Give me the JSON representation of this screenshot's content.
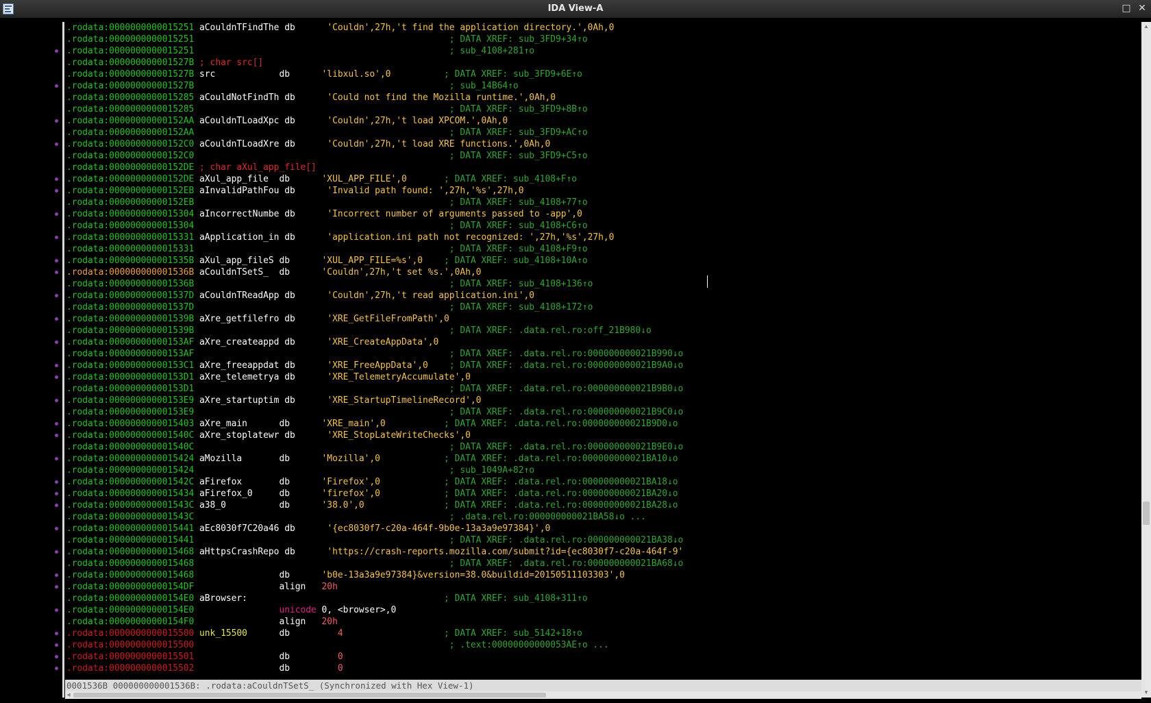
{
  "window": {
    "title": "IDA View-A",
    "app_icon": "ida-icon",
    "buttons": {
      "maximize": "□",
      "close": "✕"
    }
  },
  "listing": [
    {
      "addr": ".rodata:0000000000015251",
      "label": "aCouldnTFindThe",
      "ins": "db",
      "op": "'Couldn',27h,'t find the application directory.',0Ah,0",
      "cmt": ""
    },
    {
      "addr": ".rodata:0000000000015251",
      "label": "",
      "ins": "",
      "op": "",
      "cmt": "; DATA XREF: sub_3FD9+34↑o"
    },
    {
      "addr": ".rodata:0000000000015251",
      "label": "",
      "ins": "",
      "op": "",
      "cmt": "; sub_4108+281↑o"
    },
    {
      "addr": ".rodata:000000000001527B",
      "label": "",
      "ins": "",
      "op": "",
      "cmt": "; char src[]",
      "cmt_red": true,
      "cmt_inline": true
    },
    {
      "addr": ".rodata:000000000001527B",
      "label": "src",
      "ins": "db",
      "op": "'libxul.so',0",
      "cmt": "; DATA XREF: sub_3FD9+6E↑o"
    },
    {
      "addr": ".rodata:000000000001527B",
      "label": "",
      "ins": "",
      "op": "",
      "cmt": "; sub_14B64↑o"
    },
    {
      "addr": ".rodata:0000000000015285",
      "label": "aCouldNotFindTh",
      "ins": "db",
      "op": "'Could not find the Mozilla runtime.',0Ah,0",
      "cmt": ""
    },
    {
      "addr": ".rodata:0000000000015285",
      "label": "",
      "ins": "",
      "op": "",
      "cmt": "; DATA XREF: sub_3FD9+8B↑o"
    },
    {
      "addr": ".rodata:00000000000152AA",
      "label": "aCouldnTLoadXpc",
      "ins": "db",
      "op": "'Couldn',27h,'t load XPCOM.',0Ah,0",
      "cmt": ""
    },
    {
      "addr": ".rodata:00000000000152AA",
      "label": "",
      "ins": "",
      "op": "",
      "cmt": "; DATA XREF: sub_3FD9+AC↑o"
    },
    {
      "addr": ".rodata:00000000000152C0",
      "label": "aCouldnTLoadXre",
      "ins": "db",
      "op": "'Couldn',27h,'t load XRE functions.',0Ah,0",
      "cmt": ""
    },
    {
      "addr": ".rodata:00000000000152C0",
      "label": "",
      "ins": "",
      "op": "",
      "cmt": "; DATA XREF: sub_3FD9+C5↑o"
    },
    {
      "addr": ".rodata:00000000000152DE",
      "label": "",
      "ins": "",
      "op": "",
      "cmt": "; char aXul_app_file[]",
      "cmt_red": true,
      "cmt_inline": true
    },
    {
      "addr": ".rodata:00000000000152DE",
      "label": "aXul_app_file",
      "ins": "db",
      "op": "'XUL_APP_FILE',0",
      "cmt": "; DATA XREF: sub_4108+F↑o"
    },
    {
      "addr": ".rodata:00000000000152EB",
      "label": "aInvalidPathFou",
      "ins": "db",
      "op": "'Invalid path found: ',27h,'%s',27h,0",
      "cmt": ""
    },
    {
      "addr": ".rodata:00000000000152EB",
      "label": "",
      "ins": "",
      "op": "",
      "cmt": "; DATA XREF: sub_4108+77↑o"
    },
    {
      "addr": ".rodata:0000000000015304",
      "label": "aIncorrectNumbe",
      "ins": "db",
      "op": "'Incorrect number of arguments passed to -app',0",
      "cmt": ""
    },
    {
      "addr": ".rodata:0000000000015304",
      "label": "",
      "ins": "",
      "op": "",
      "cmt": "; DATA XREF: sub_4108+C6↑o"
    },
    {
      "addr": ".rodata:0000000000015331",
      "label": "aApplication_in",
      "ins": "db",
      "op": "'application.ini path not recognized: ',27h,'%s',27h,0",
      "cmt": ""
    },
    {
      "addr": ".rodata:0000000000015331",
      "label": "",
      "ins": "",
      "op": "",
      "cmt": "; DATA XREF: sub_4108+F9↑o"
    },
    {
      "addr": ".rodata:000000000001535B",
      "label": "aXul_app_fileS",
      "ins": "db",
      "op": "'XUL_APP_FILE=%s',0",
      "cmt": "; DATA XREF: sub_4108+10A↑o"
    },
    {
      "addr": ".rodata:000000000001536B",
      "label": "aCouldnTSetS_",
      "ins": "db",
      "op": "'Couldn',27h,'t set %s.',0Ah,0",
      "cmt": "",
      "addr_orange": true
    },
    {
      "addr": ".rodata:000000000001536B",
      "label": "",
      "ins": "",
      "op": "",
      "cmt": "; DATA XREF: sub_4108+136↑o"
    },
    {
      "addr": ".rodata:000000000001537D",
      "label": "aCouldnTReadApp",
      "ins": "db",
      "op": "'Couldn',27h,'t read application.ini',0",
      "cmt": ""
    },
    {
      "addr": ".rodata:000000000001537D",
      "label": "",
      "ins": "",
      "op": "",
      "cmt": "; DATA XREF: sub_4108+172↑o"
    },
    {
      "addr": ".rodata:000000000001539B",
      "label": "aXre_getfilefro",
      "ins": "db",
      "op": "'XRE_GetFileFromPath',0",
      "cmt": ""
    },
    {
      "addr": ".rodata:000000000001539B",
      "label": "",
      "ins": "",
      "op": "",
      "cmt": "; DATA XREF: .data.rel.ro:off_21B980↓o"
    },
    {
      "addr": ".rodata:00000000000153AF",
      "label": "aXre_createappd",
      "ins": "db",
      "op": "'XRE_CreateAppData',0",
      "cmt": ""
    },
    {
      "addr": ".rodata:00000000000153AF",
      "label": "",
      "ins": "",
      "op": "",
      "cmt": "; DATA XREF: .data.rel.ro:000000000021B990↓o"
    },
    {
      "addr": ".rodata:00000000000153C1",
      "label": "aXre_freeappdat",
      "ins": "db",
      "op": "'XRE_FreeAppData',0",
      "cmt": "; DATA XREF: .data.rel.ro:000000000021B9A0↓o"
    },
    {
      "addr": ".rodata:00000000000153D1",
      "label": "aXre_telemetrya",
      "ins": "db",
      "op": "'XRE_TelemetryAccumulate',0",
      "cmt": ""
    },
    {
      "addr": ".rodata:00000000000153D1",
      "label": "",
      "ins": "",
      "op": "",
      "cmt": "; DATA XREF: .data.rel.ro:000000000021B9B0↓o"
    },
    {
      "addr": ".rodata:00000000000153E9",
      "label": "aXre_startuptim",
      "ins": "db",
      "op": "'XRE_StartupTimelineRecord',0",
      "cmt": ""
    },
    {
      "addr": ".rodata:00000000000153E9",
      "label": "",
      "ins": "",
      "op": "",
      "cmt": "; DATA XREF: .data.rel.ro:000000000021B9C0↓o"
    },
    {
      "addr": ".rodata:0000000000015403",
      "label": "aXre_main",
      "ins": "db",
      "op": "'XRE_main',0",
      "cmt": "; DATA XREF: .data.rel.ro:000000000021B9D0↓o"
    },
    {
      "addr": ".rodata:000000000001540C",
      "label": "aXre_stoplatewr",
      "ins": "db",
      "op": "'XRE_StopLateWriteChecks',0",
      "cmt": ""
    },
    {
      "addr": ".rodata:000000000001540C",
      "label": "",
      "ins": "",
      "op": "",
      "cmt": "; DATA XREF: .data.rel.ro:000000000021B9E0↓o"
    },
    {
      "addr": ".rodata:0000000000015424",
      "label": "aMozilla",
      "ins": "db",
      "op": "'Mozilla',0",
      "cmt": "; DATA XREF: .data.rel.ro:000000000021BA10↓o"
    },
    {
      "addr": ".rodata:0000000000015424",
      "label": "",
      "ins": "",
      "op": "",
      "cmt": "; sub_1049A+82↑o"
    },
    {
      "addr": ".rodata:000000000001542C",
      "label": "aFirefox",
      "ins": "db",
      "op": "'Firefox',0",
      "cmt": "; DATA XREF: .data.rel.ro:000000000021BA18↓o"
    },
    {
      "addr": ".rodata:0000000000015434",
      "label": "aFirefox_0",
      "ins": "db",
      "op": "'firefox',0",
      "cmt": "; DATA XREF: .data.rel.ro:000000000021BA20↓o"
    },
    {
      "addr": ".rodata:000000000001543C",
      "label": "a38_0",
      "ins": "db",
      "op": "'38.0',0",
      "cmt": "; DATA XREF: .data.rel.ro:000000000021BA28↓o"
    },
    {
      "addr": ".rodata:000000000001543C",
      "label": "",
      "ins": "",
      "op": "",
      "cmt": "; .data.rel.ro:000000000021BA58↓o ..."
    },
    {
      "addr": ".rodata:0000000000015441",
      "label": "aEc8030f7C20a46",
      "ins": "db",
      "op": "'{ec8030f7-c20a-464f-9b0e-13a3a9e97384}',0",
      "cmt": ""
    },
    {
      "addr": ".rodata:0000000000015441",
      "label": "",
      "ins": "",
      "op": "",
      "cmt": "; DATA XREF: .data.rel.ro:000000000021BA38↓o"
    },
    {
      "addr": ".rodata:0000000000015468",
      "label": "aHttpsCrashRepo",
      "ins": "db",
      "op": "'https://crash-reports.mozilla.com/submit?id={ec8030f7-c20a-464f-9'",
      "cmt": ""
    },
    {
      "addr": ".rodata:0000000000015468",
      "label": "",
      "ins": "",
      "op": "",
      "cmt": "; DATA XREF: .data.rel.ro:000000000021BA68↓o"
    },
    {
      "addr": ".rodata:0000000000015468",
      "label": "",
      "ins": "db",
      "op": "'b0e-13a3a9e97384}&version=38.0&buildid=20150511103303',0",
      "cmt": ""
    },
    {
      "addr": ".rodata:00000000000154DF",
      "label": "",
      "ins": "align",
      "op": "20h",
      "cmt": "",
      "op_red": true
    },
    {
      "addr": ".rodata:00000000000154E0",
      "label": "aBrowser:",
      "ins": "",
      "op": "",
      "cmt": "; DATA XREF: sub_4108+311↑o"
    },
    {
      "addr": ".rodata:00000000000154E0",
      "label": "",
      "ins": "unicode",
      "op": "0, <browser>,0",
      "cmt": "",
      "ins_mag": true,
      "op_plain": true
    },
    {
      "addr": ".rodata:00000000000154F0",
      "label": "",
      "ins": "align",
      "op": "20h",
      "cmt": "",
      "op_red": true
    },
    {
      "addr": ".rodata:0000000000015500",
      "label": "unk_15500",
      "ins": "db",
      "op": "   4",
      "cmt": "; DATA XREF: sub_5142+18↑o",
      "addr_red": true,
      "label_yellow": true,
      "op_red": true
    },
    {
      "addr": ".rodata:0000000000015500",
      "label": "",
      "ins": "",
      "op": "",
      "cmt": "; .text:00000000000053AE↑o ...",
      "addr_red": true
    },
    {
      "addr": ".rodata:0000000000015501",
      "label": "",
      "ins": "db",
      "op": "   0",
      "cmt": "",
      "addr_red": true,
      "op_red": true
    },
    {
      "addr": ".rodata:0000000000015502",
      "label": "",
      "ins": "db",
      "op": "   0",
      "cmt": "",
      "addr_red": true,
      "op_red": true
    }
  ],
  "gutter_dots": [
    2,
    5,
    8,
    10,
    13,
    14,
    16,
    18,
    20,
    21,
    23,
    25,
    27,
    29,
    30,
    32,
    34,
    35,
    37,
    39,
    40,
    41,
    43,
    45,
    47,
    48,
    50,
    52,
    53,
    54,
    55
  ],
  "status_bar": "0001536B 000000000001536B: .rodata:aCouldnTSetS_ (Synchronized with Hex View-1)",
  "colors": {
    "address": "#1ec51e",
    "address_selected": "#f0a030",
    "address_undefined": "#d11a1a",
    "string_operand": "#f6c441",
    "comment": "#2fa82f",
    "type_comment": "#e02828",
    "unicode_directive": "#e0208a",
    "gutter_marker": "#8a3fb0"
  }
}
